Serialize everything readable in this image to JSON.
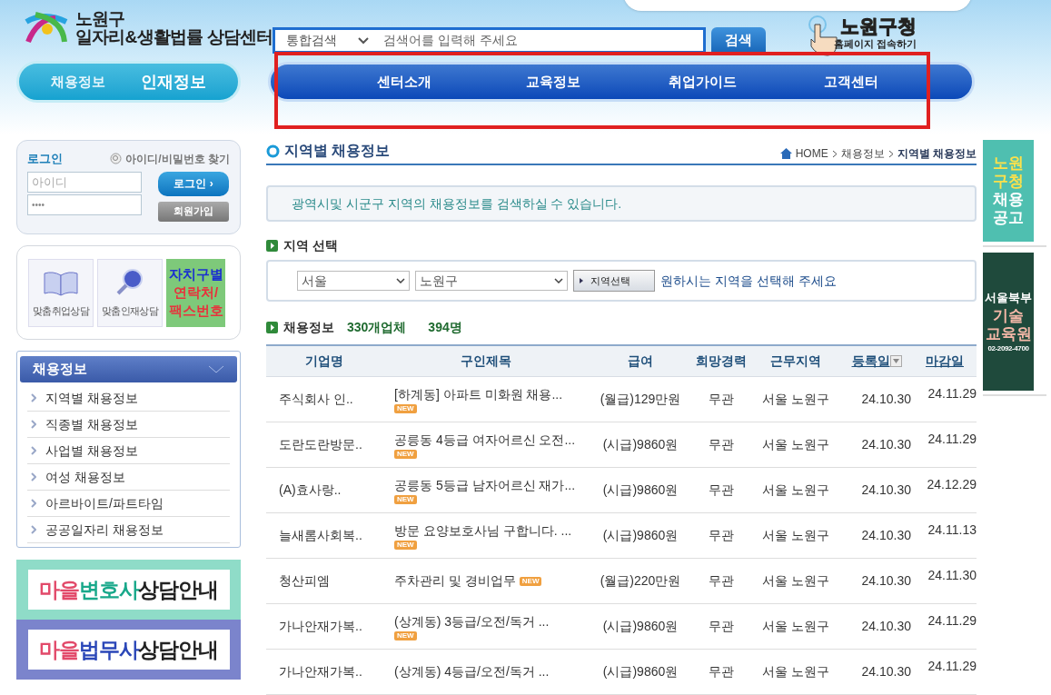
{
  "logo": {
    "line1": "노원구",
    "line2": "일자리&생활법률 상담센터"
  },
  "search": {
    "scope": "통합검색",
    "placeholder": "검색어를 입력해 주세요",
    "button": "검색"
  },
  "promo": {
    "title": "노원구청",
    "subtitle": "홈페이지 접속하기"
  },
  "top_tabs": [
    {
      "label": "채용정보",
      "selected": false
    },
    {
      "label": "인재정보",
      "selected": true
    }
  ],
  "nav": [
    "센터소개",
    "교육정보",
    "취업가이드",
    "고객센터"
  ],
  "login": {
    "title": "로그인",
    "find": "아이디/비밀번호 찾기",
    "id_placeholder": "아이디",
    "password": "••••",
    "login_button": "로그인 ›",
    "join_button": "회원가입"
  },
  "quick": [
    {
      "kind": "book",
      "label": "맞춤취업상담"
    },
    {
      "kind": "magnifier",
      "label": "맞춤인재상담"
    },
    {
      "kind": "tile",
      "lines": [
        {
          "text": "자치구별",
          "color": "#1a2fd0"
        },
        {
          "text": "연락처/",
          "color": "#e8323c"
        },
        {
          "text": "팩스번호",
          "color": "#e8323c"
        }
      ]
    }
  ],
  "side_menu": {
    "title": "채용정보",
    "items": [
      "지역별 채용정보",
      "직종별 채용정보",
      "사업별 채용정보",
      "여성 채용정보",
      "아르바이트/파트타임",
      "공공일자리 채용정보"
    ]
  },
  "banners": [
    {
      "color": "#8fdcc8",
      "parts": [
        {
          "text": "마을",
          "color": "#e24a6a"
        },
        {
          "text": "변호사",
          "color": "#18a88a"
        },
        {
          "text": "상담안내",
          "color": "#222222"
        }
      ]
    },
    {
      "color": "#7b84cc",
      "parts": [
        {
          "text": "마을",
          "color": "#e24a6a"
        },
        {
          "text": "법무사",
          "color": "#2b47b8"
        },
        {
          "text": "상담안내",
          "color": "#222222"
        }
      ]
    }
  ],
  "page": {
    "title": "지역별 채용정보",
    "breadcrumb": [
      "HOME",
      "채용정보",
      "지역별 채용정보"
    ],
    "notice": "광역시및 시군구 지역의 채용정보를 검색하실 수 있습니다."
  },
  "region": {
    "title": "지역 선택",
    "city": "서울",
    "district": "노원구",
    "button": "지역선택",
    "hint": "원하시는 지역을 선택해 주세요"
  },
  "summary": {
    "title": "채용정보",
    "companies": "330개업체",
    "people": "394명"
  },
  "table": {
    "columns": [
      {
        "label": "기업명",
        "link": false
      },
      {
        "label": "구인제목",
        "link": false
      },
      {
        "label": "급여",
        "link": false
      },
      {
        "label": "희망경력",
        "link": false
      },
      {
        "label": "근무지역",
        "link": false
      },
      {
        "label": "등록일",
        "link": true
      },
      {
        "label": "마감일",
        "link": true
      }
    ],
    "rows": [
      {
        "company": "주식회사 인..",
        "title": "[하계동] 아파트 미화원 채용...",
        "badge": "NEW",
        "salary": "(월급)129만원",
        "experience": "무관",
        "region": "서울 노원구",
        "registered": "24.10.30",
        "deadline": "24.11.29"
      },
      {
        "company": "도란도란방문..",
        "title": "공릉동 4등급 여자어르신 오전...",
        "badge": "NEW",
        "salary": "(시급)9860원",
        "experience": "무관",
        "region": "서울 노원구",
        "registered": "24.10.30",
        "deadline": "24.11.29"
      },
      {
        "company": "(A)효사랑..",
        "title": "공릉동 5등급 남자어르신 재가...",
        "badge": "NEW",
        "salary": "(시급)9860원",
        "experience": "무관",
        "region": "서울 노원구",
        "registered": "24.10.30",
        "deadline": "24.12.29"
      },
      {
        "company": "늘새롬사회복..",
        "title": "방문 요양보호사님 구합니다. ...",
        "badge": "NEW",
        "salary": "(시급)9860원",
        "experience": "무관",
        "region": "서울 노원구",
        "registered": "24.10.30",
        "deadline": "24.11.13"
      },
      {
        "company": "청산피엠",
        "title": "주차관리 및 경비업무",
        "inline_badge": "NEW",
        "salary": "(월급)220만원",
        "experience": "무관",
        "region": "서울 노원구",
        "registered": "24.10.30",
        "deadline": "24.11.30"
      },
      {
        "company": "가나안재가복..",
        "title": "(상계동) 3등급/오전/독거 ...",
        "badge": "NEW",
        "salary": "(시급)9860원",
        "experience": "무관",
        "region": "서울 노원구",
        "registered": "24.10.30",
        "deadline": "24.11.29"
      },
      {
        "company": "가나안재가복..",
        "title": "(상계동) 4등급/오전/독거 ...",
        "salary": "(시급)9860원",
        "experience": "무관",
        "region": "서울 노원구",
        "registered": "24.10.30",
        "deadline": "24.11.29"
      }
    ]
  },
  "ads": [
    {
      "color": "#4fbfb0",
      "lines": [
        {
          "text": "노원",
          "color": "#ffe14a"
        },
        {
          "text": "구청",
          "color": "#ffe14a"
        },
        {
          "text": "채용",
          "color": "#ffffff"
        },
        {
          "text": "공고",
          "color": "#ffffff"
        }
      ]
    },
    {
      "color": "#1f4a3c",
      "lines": [
        {
          "text": "서울북부",
          "color": "#ffffff"
        },
        {
          "text": "기술",
          "color": "#f5b8a8"
        },
        {
          "text": "교육원",
          "color": "#f5b8a8"
        },
        {
          "text": "02-2092-4700",
          "color": "#ffffff"
        }
      ]
    }
  ]
}
